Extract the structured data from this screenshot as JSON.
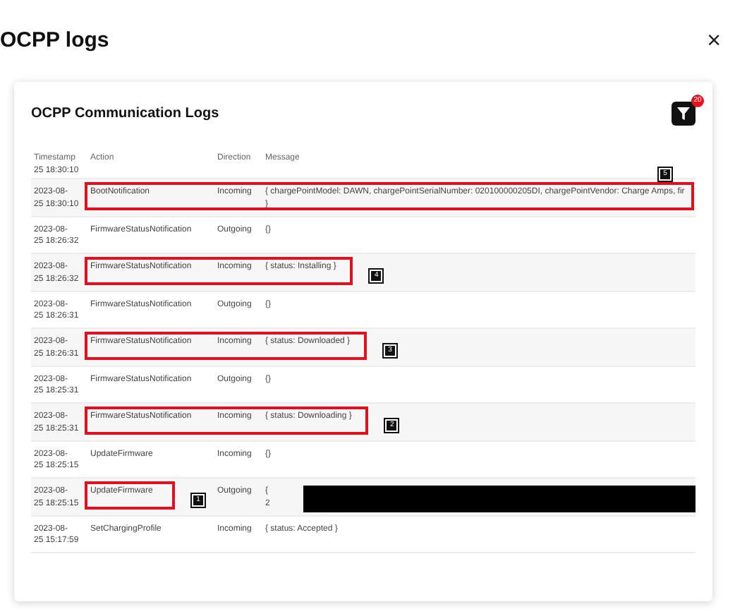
{
  "modal": {
    "title": "OCPP logs",
    "close": "×"
  },
  "card": {
    "title": "OCPP Communication Logs",
    "filter_count": "20"
  },
  "table": {
    "columns": [
      "Timestamp",
      "Action",
      "Direction",
      "Message"
    ],
    "rows": [
      {
        "timestamp": [
          "25 18:30:10"
        ],
        "action": "",
        "direction": "",
        "message": []
      },
      {
        "timestamp": [
          "2023-08-",
          "25 18:30:10"
        ],
        "action": "BootNotification",
        "direction": "Incoming",
        "message": [
          "{ chargePointModel: DAWN, chargePointSerialNumber: 020100000205DI, chargePointVendor: Charge Amps, fir",
          "}"
        ],
        "annotation": {
          "kind": "through-message",
          "marker": "5"
        }
      },
      {
        "timestamp": [
          "2023-08-",
          "25 18:26:32"
        ],
        "action": "FirmwareStatusNotification",
        "direction": "Outgoing",
        "message": [
          "{}"
        ]
      },
      {
        "timestamp": [
          "2023-08-",
          "25 18:26:32"
        ],
        "action": "FirmwareStatusNotification",
        "direction": "Incoming",
        "message": [
          "{ status: Installing }"
        ],
        "annotation": {
          "kind": "through-message",
          "marker": "4"
        }
      },
      {
        "timestamp": [
          "2023-08-",
          "25 18:26:31"
        ],
        "action": "FirmwareStatusNotification",
        "direction": "Outgoing",
        "message": [
          "{}"
        ]
      },
      {
        "timestamp": [
          "2023-08-",
          "25 18:26:31"
        ],
        "action": "FirmwareStatusNotification",
        "direction": "Incoming",
        "message": [
          "{ status: Downloaded }"
        ],
        "annotation": {
          "kind": "through-message",
          "marker": "3"
        }
      },
      {
        "timestamp": [
          "2023-08-",
          "25 18:25:31"
        ],
        "action": "FirmwareStatusNotification",
        "direction": "Outgoing",
        "message": [
          "{}"
        ]
      },
      {
        "timestamp": [
          "2023-08-",
          "25 18:25:31"
        ],
        "action": "FirmwareStatusNotification",
        "direction": "Incoming",
        "message": [
          "{ status: Downloading }"
        ],
        "annotation": {
          "kind": "through-message",
          "marker": "2"
        }
      },
      {
        "timestamp": [
          "2023-08-",
          "25 18:25:15"
        ],
        "action": "UpdateFirmware",
        "direction": "Incoming",
        "message": [
          "{}"
        ]
      },
      {
        "timestamp": [
          "2023-08-",
          "25 18:25:15"
        ],
        "action": "UpdateFirmware",
        "direction": "Outgoing",
        "message": [
          "{",
          "2"
        ],
        "annotation": {
          "kind": "action",
          "marker": "1"
        },
        "redacted": true
      },
      {
        "timestamp": [
          "2023-08-",
          "25 15:17:59"
        ],
        "action": "SetChargingProfile",
        "direction": "Incoming",
        "message": [
          "{ status: Accepted }"
        ]
      }
    ]
  }
}
